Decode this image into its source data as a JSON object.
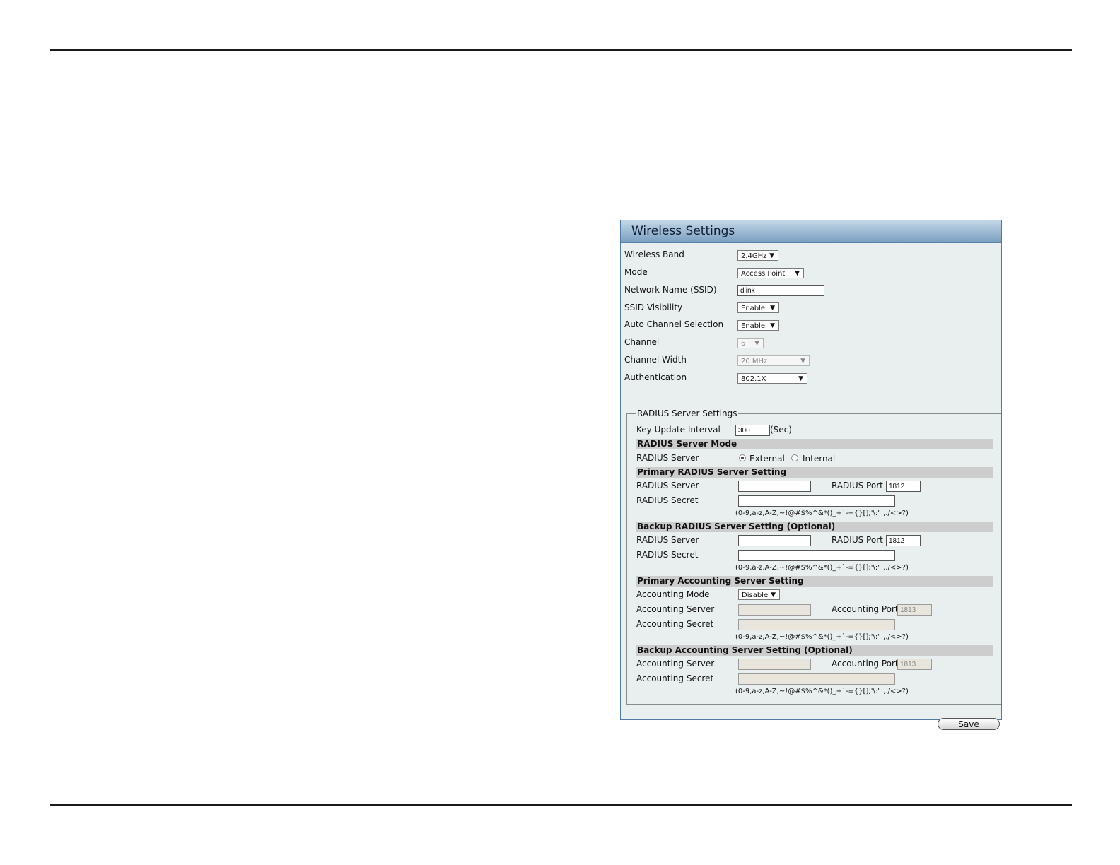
{
  "panel": {
    "title": "Wireless Settings",
    "fields": {
      "wireless_band": {
        "label": "Wireless Band",
        "value": "2.4GHz"
      },
      "mode": {
        "label": "Mode",
        "value": "Access Point"
      },
      "ssid": {
        "label": "Network Name (SSID)",
        "value": "dlink"
      },
      "ssid_visibility": {
        "label": "SSID Visibility",
        "value": "Enable"
      },
      "auto_channel": {
        "label": "Auto Channel Selection",
        "value": "Enable"
      },
      "channel": {
        "label": "Channel",
        "value": "6"
      },
      "channel_width": {
        "label": "Channel Width",
        "value": "20 MHz"
      },
      "authentication": {
        "label": "Authentication",
        "value": "802.1X"
      }
    },
    "radius": {
      "legend": "RADIUS Server Settings",
      "key_update": {
        "label": "Key Update Interval",
        "value": "300",
        "unit": "(Sec)"
      },
      "server_mode": {
        "heading": "RADIUS Server Mode",
        "label": "RADIUS Server",
        "options": [
          "External",
          "Internal"
        ],
        "selected": "External"
      },
      "primary": {
        "heading": "Primary RADIUS Server Setting",
        "server_label": "RADIUS Server",
        "server_value": "",
        "port_label": "RADIUS Port",
        "port_value": "1812",
        "secret_label": "RADIUS Secret",
        "secret_value": "",
        "hint": "(0-9,a-z,A-Z,~!@#$%^&*()_+`-={}[];'\\:\"|,./<>?)"
      },
      "backup": {
        "heading": "Backup RADIUS Server Setting (Optional)",
        "server_label": "RADIUS Server",
        "server_value": "",
        "port_label": "RADIUS Port",
        "port_value": "1812",
        "secret_label": "RADIUS Secret",
        "secret_value": "",
        "hint": "(0-9,a-z,A-Z,~!@#$%^&*()_+`-={}[];'\\:\"|,./<>?)"
      },
      "primary_accounting": {
        "heading": "Primary Accounting Server Setting",
        "mode_label": "Accounting Mode",
        "mode_value": "Disable",
        "server_label": "Accounting Server",
        "server_value": "",
        "port_label": "Accounting Port",
        "port_value": "1813",
        "secret_label": "Accounting Secret",
        "secret_value": "",
        "hint": "(0-9,a-z,A-Z,~!@#$%^&*()_+`-={}[];'\\:\"|,./<>?)"
      },
      "backup_accounting": {
        "heading": "Backup Accounting Server Setting (Optional)",
        "server_label": "Accounting Server",
        "server_value": "",
        "port_label": "Accounting Port",
        "port_value": "1813",
        "secret_label": "Accounting Secret",
        "secret_value": "",
        "hint": "(0-9,a-z,A-Z,~!@#$%^&*()_+`-={}[];'\\:\"|,./<>?)"
      }
    },
    "save_label": "Save"
  }
}
